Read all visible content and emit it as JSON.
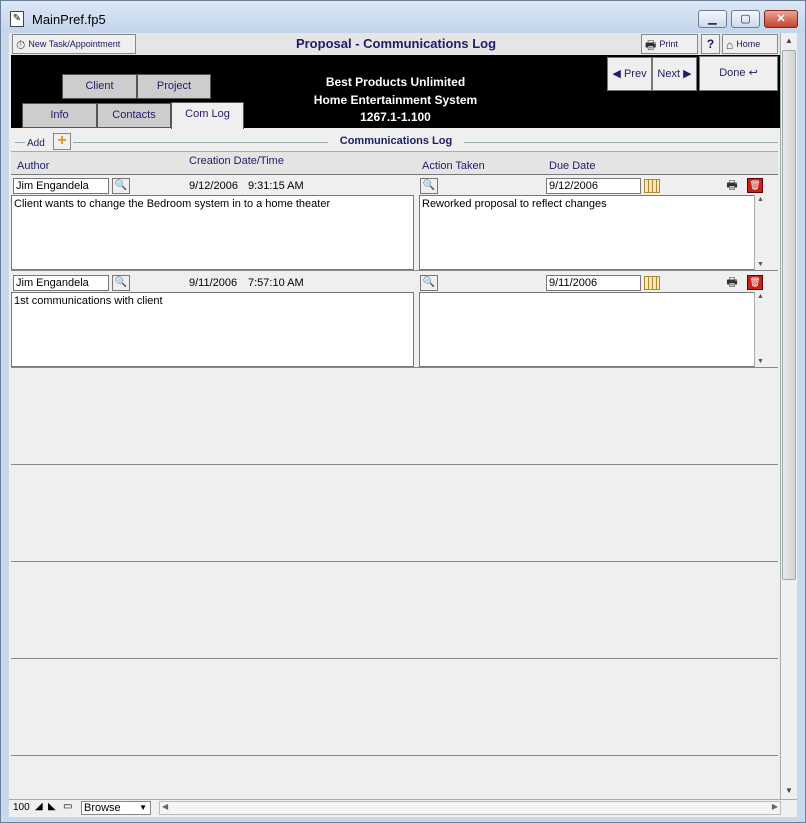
{
  "window": {
    "title": "MainPref.fp5",
    "minimize": "▁",
    "maximize": "▢",
    "close": "✕"
  },
  "header": {
    "new_task_label": "New Task/Appointment",
    "title": "Proposal - Communications Log",
    "print_label": "Print",
    "help_label": "?",
    "home_label": "Home"
  },
  "banner": {
    "company": "Best Products Unlimited",
    "project": "Home Entertainment System",
    "number": "1267.1-1.100"
  },
  "tabs": {
    "client": "Client",
    "project": "Project",
    "info": "Info",
    "contacts": "Contacts",
    "comlog": "Com Log"
  },
  "nav": {
    "prev": "Prev",
    "next": "Next",
    "done": "Done"
  },
  "section": {
    "add_label": "Add",
    "title": "Communications Log"
  },
  "columns": {
    "author": "Author",
    "creation": "Creation Date/Time",
    "action": "Action Taken",
    "due": "Due Date"
  },
  "records": [
    {
      "author": "Jim Engandela",
      "date": "9/12/2006",
      "time": "9:31:15 AM",
      "due": "9/12/2006",
      "note": "Client wants to change the Bedroom system in to a home theater",
      "action": "Reworked proposal to reflect changes"
    },
    {
      "author": "Jim Engandela",
      "date": "9/11/2006",
      "time": "7:57:10 AM",
      "due": "9/11/2006",
      "note": "1st communications with client",
      "action": ""
    }
  ],
  "status": {
    "zoom": "100",
    "mode": "Browse"
  }
}
